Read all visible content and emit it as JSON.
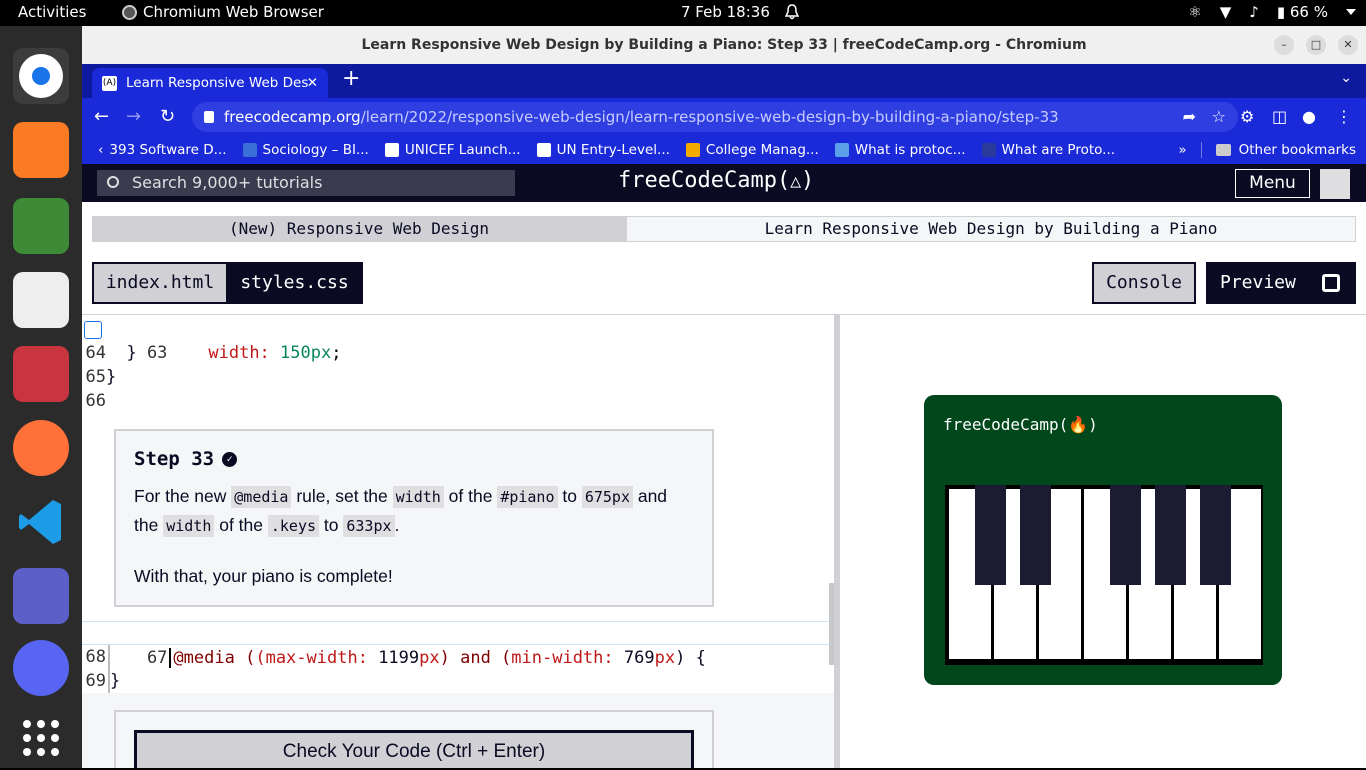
{
  "topbar": {
    "activities": "Activities",
    "app_name": "Chromium Web Browser",
    "clock": "7 Feb  18:36",
    "battery": "66 %"
  },
  "dock": {
    "items": [
      "chromium",
      "xampp",
      "text-editor",
      "document-viewer",
      "files",
      "firefox",
      "vscode",
      "teams",
      "discord",
      "app-grid"
    ]
  },
  "browser": {
    "window_title": "Learn Responsive Web Design by Building a Piano: Step 33 | freeCodeCamp.org - Chromium",
    "tab_title": "Learn Responsive Web Des",
    "url_host": "freecodecamp.org",
    "url_path": "/learn/2022/responsive-web-design/learn-responsive-web-design-by-building-a-piano/step-33",
    "bookmarks": [
      {
        "label": "393 Software D..."
      },
      {
        "label": "Sociology – BI..."
      },
      {
        "label": "UNICEF Launch..."
      },
      {
        "label": "UN Entry-Level..."
      },
      {
        "label": "College Manag..."
      },
      {
        "label": "What is protoc..."
      },
      {
        "label": "What are Proto..."
      }
    ],
    "other_bookmarks": "Other bookmarks"
  },
  "fcc": {
    "search_placeholder": "Search 9,000+ tutorials",
    "logo": "freeCodeCamp(🔥)",
    "logo_text": "freeCodeCamp(",
    "menu": "Menu",
    "breadcrumb_1": "(New) Responsive Web Design",
    "breadcrumb_2": "Learn Responsive Web Design by Building a Piano",
    "tabs": {
      "index": "index.html",
      "styles": "styles.css"
    },
    "console": "Console",
    "preview": "Preview"
  },
  "editor": {
    "lines": [
      {
        "num": "63",
        "indent": "    ",
        "prop": "width:",
        "value": "150px",
        "tail": ";"
      },
      {
        "num": "64",
        "text": "  }"
      },
      {
        "num": "65",
        "text": "}"
      },
      {
        "num": "66",
        "text": ""
      },
      {
        "num": "67"
      },
      {
        "num": "68",
        "text": ""
      },
      {
        "num": "69",
        "text": "}"
      }
    ],
    "media_line": {
      "at": "@media",
      "p1": "(max-width:",
      "v1": "1199",
      "u1": "px",
      "and": ") and (",
      "p2": "min-width:",
      "v2": "769",
      "u2": "px",
      "end": ") {"
    }
  },
  "step": {
    "title": "Step 33",
    "p1_a": "For the new ",
    "code_media": "@media",
    "p1_b": " rule, set the ",
    "code_width1": "width",
    "p1_c": " of the ",
    "code_piano": "#piano",
    "p1_d": " to ",
    "code_675": "675px",
    "p1_e": " and the ",
    "code_width2": "width",
    "p1_f": " of the ",
    "code_keys": ".keys",
    "p1_g": " to ",
    "code_633": "633px",
    "p1_h": ".",
    "p2": "With that, your piano is complete!",
    "check_button": "Check Your Code (Ctrl + Enter)"
  },
  "preview_pane": {
    "piano_logo": "freeCodeCamp(🔥)"
  }
}
